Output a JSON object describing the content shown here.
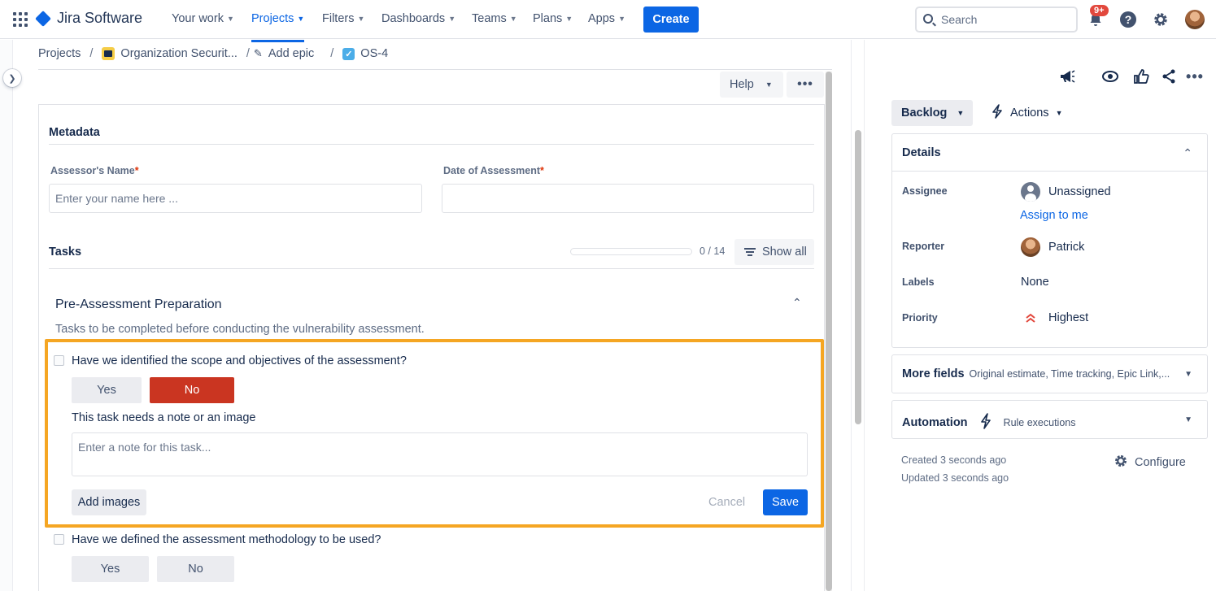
{
  "nav": {
    "logo": "Jira Software",
    "items": [
      {
        "label": "Your work",
        "active": false
      },
      {
        "label": "Projects",
        "active": true
      },
      {
        "label": "Filters",
        "active": false
      },
      {
        "label": "Dashboards",
        "active": false
      },
      {
        "label": "Teams",
        "active": false
      },
      {
        "label": "Plans",
        "active": false
      },
      {
        "label": "Apps",
        "active": false
      }
    ],
    "create_label": "Create",
    "search_placeholder": "Search",
    "notifications_badge": "9+",
    "help_glyph": "?",
    "icons": [
      "app-switcher-icon",
      "search-icon",
      "bell-icon",
      "help-icon",
      "gear-icon",
      "avatar"
    ]
  },
  "breadcrumb": {
    "projects": "Projects",
    "project": "Organization Securit...",
    "epic": "Add epic",
    "issue": "OS-4",
    "separator": "/"
  },
  "toolbar": {
    "help_label": "Help",
    "more_label": "•••"
  },
  "metadata": {
    "title": "Metadata",
    "assessor_label": "Assessor's Name",
    "assessor_placeholder": "Enter your name here ...",
    "date_label": "Date of Assessment",
    "date_value": "",
    "required_mark": "*"
  },
  "tasks": {
    "title": "Tasks",
    "progress_text": "0 / 14",
    "progress_fraction": 0,
    "show_all_label": "Show all",
    "group": {
      "title": "Pre-Assessment Preparation",
      "description": "Tasks to be completed before conducting the vulnerability assessment."
    },
    "items": [
      {
        "question": "Have we identified the scope and objectives of the assessment?",
        "yes_label": "Yes",
        "no_label": "No",
        "selected": "No",
        "note_prompt": "This task needs a note or an image",
        "note_placeholder": "Enter a note for this task...",
        "add_images_label": "Add images",
        "cancel_label": "Cancel",
        "save_label": "Save"
      },
      {
        "question": "Have we defined the assessment methodology to be used?",
        "yes_label": "Yes",
        "no_label": "No",
        "selected": ""
      }
    ]
  },
  "right_panel": {
    "status_label": "Backlog",
    "actions_label": "Actions",
    "details": {
      "title": "Details",
      "assignee_label": "Assignee",
      "assignee_value": "Unassigned",
      "assign_to_me": "Assign to me",
      "reporter_label": "Reporter",
      "reporter_value": "Patrick",
      "labels_label": "Labels",
      "labels_value": "None",
      "priority_label": "Priority",
      "priority_value": "Highest"
    },
    "more_fields": {
      "title": "More fields",
      "summary": "Original estimate, Time tracking, Epic Link,..."
    },
    "automation": {
      "title": "Automation",
      "summary": "Rule executions"
    },
    "created": "Created 3 seconds ago",
    "updated": "Updated 3 seconds ago",
    "configure_label": "Configure"
  },
  "colors": {
    "accent": "#0c66e4",
    "no_selected": "#ca3521",
    "highlight": "#f5a623",
    "priority": "#e2483d"
  }
}
